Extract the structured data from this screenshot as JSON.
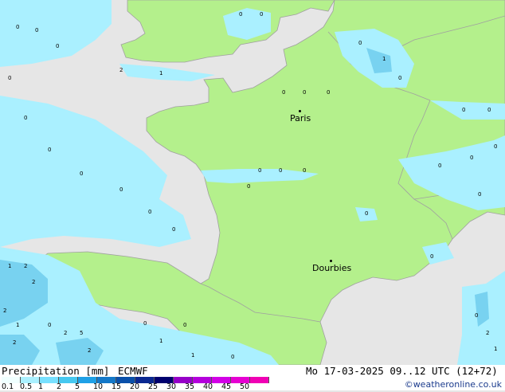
{
  "map": {
    "cities": [
      {
        "name": "Paris"
      },
      {
        "name": "Dourbies"
      }
    ],
    "colors": {
      "sea": "#e6e6e6",
      "land": "#b4f08c",
      "precip_light": "#aaf0ff",
      "precip_medium": "#78d2f0",
      "border": "#a0a0a0"
    },
    "precip_marker_values": [
      "0",
      "1",
      "2",
      "5"
    ]
  },
  "footer": {
    "title": "Precipitation [mm]",
    "model": "ECMWF",
    "datetime": "Mo 17-03-2025 09..12 UTC (12+72)",
    "credit": "©weatheronline.co.uk",
    "legend_values": [
      "0.1",
      "0.5",
      "1",
      "2",
      "5",
      "10",
      "15",
      "20",
      "25",
      "30",
      "35",
      "40",
      "45",
      "50"
    ],
    "legend_colors": [
      "#f0ffff",
      "#aaf0ff",
      "#78e0ff",
      "#46c8f0",
      "#1ea0e6",
      "#1478c8",
      "#0a50aa",
      "#0a2891",
      "#00006e",
      "#9600c8",
      "#b400dc",
      "#d200e6",
      "#e600d2",
      "#f000b4"
    ]
  }
}
